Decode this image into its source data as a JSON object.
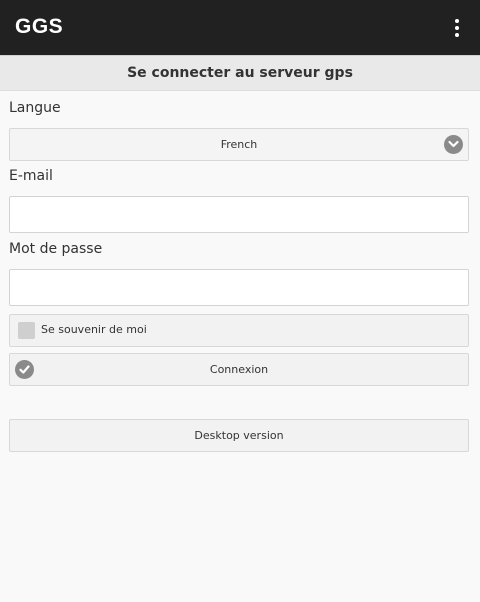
{
  "appbar": {
    "title": "GGS",
    "menu_icon": "more-vert-icon"
  },
  "header": {
    "title": "Se connecter au serveur gps"
  },
  "form": {
    "language_label": "Langue",
    "language_value": "French",
    "email_label": "E-mail",
    "email_value": "",
    "password_label": "Mot de passe",
    "password_value": "",
    "remember_label": "Se souvenir de moi",
    "remember_checked": false,
    "login_button": "Connexion"
  },
  "footer": {
    "desktop_button": "Desktop version"
  },
  "colors": {
    "appbar": "#212121",
    "background": "#f9f9f9",
    "icon_gray": "#8a8a8a"
  }
}
